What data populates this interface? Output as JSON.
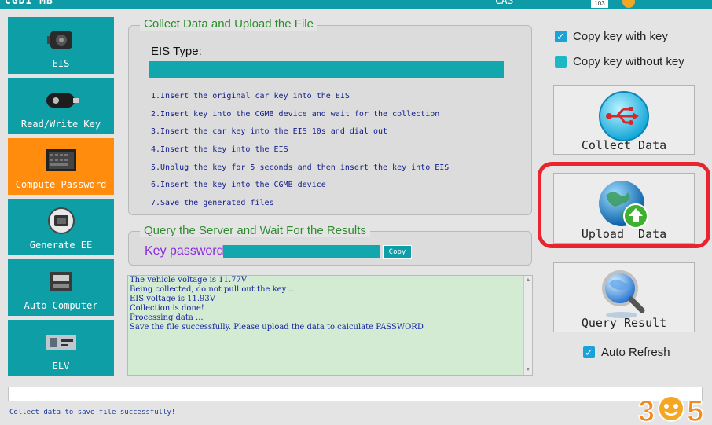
{
  "title_bar": {
    "title": "CGDI MB",
    "cas_label": "CAS",
    "badge": "103"
  },
  "nav": [
    {
      "label": "EIS",
      "icon": "eis-device-icon",
      "active": false
    },
    {
      "label": "Read/Write Key",
      "icon": "car-key-icon",
      "active": false
    },
    {
      "label": "Compute Password",
      "icon": "computer-chip-icon",
      "active": true
    },
    {
      "label": "Generate EE",
      "icon": "chip-icon",
      "active": false
    },
    {
      "label": "Auto Computer",
      "icon": "ecu-module-icon",
      "active": false
    },
    {
      "label": "ELV",
      "icon": "elv-module-icon",
      "active": false
    }
  ],
  "collect": {
    "legend": "Collect Data and Upload the File",
    "eis_type_label": "EIS Type:",
    "steps": [
      "1.Insert the original car key into the EIS",
      "2.Insert key into the CGMB device and wait for the collection",
      "3.Insert the car key into the EIS 10s and dial out",
      "4.Insert the key into the EIS",
      "5.Unplug the key for 5 seconds and then insert the key into EIS",
      "6.Insert the key into the CGMB device",
      "7.Save the generated files"
    ]
  },
  "query": {
    "legend": "Query the Server and Wait For the Results",
    "key_password_label": "Key password",
    "key_password_value": "",
    "copy_label": "Copy"
  },
  "log": {
    "lines": [
      "The vehicle voltage is 11.77V",
      "Being collected, do not pull out the key ...",
      "EIS voltage is 11.93V",
      "Collection is done!",
      "Processing data ...",
      "Save the file successfully. Please upload the data to calculate PASSWORD"
    ]
  },
  "options": {
    "copy_with_key": {
      "label": "Copy key with key",
      "checked": true
    },
    "copy_without_key": {
      "label": "Copy key without key",
      "checked": false
    },
    "auto_refresh": {
      "label": "Auto Refresh",
      "checked": true
    }
  },
  "actions": {
    "collect": {
      "label": "Collect Data",
      "icon": "usb-icon"
    },
    "upload": {
      "label": "Upload  Data",
      "icon": "globe-upload-icon"
    },
    "query": {
      "label": "Query Result",
      "icon": "globe-search-icon"
    }
  },
  "status": {
    "input_value": "",
    "message": "Collect data to save file successfully!"
  },
  "watermark": {
    "text": "365"
  },
  "colors": {
    "teal": "#0e9ea6",
    "orange": "#ff8c0c",
    "highlight": "#e8242d",
    "log_bg": "#d3ebd3",
    "legend_green": "#2d8b2d",
    "step_blue": "#111d8b"
  }
}
